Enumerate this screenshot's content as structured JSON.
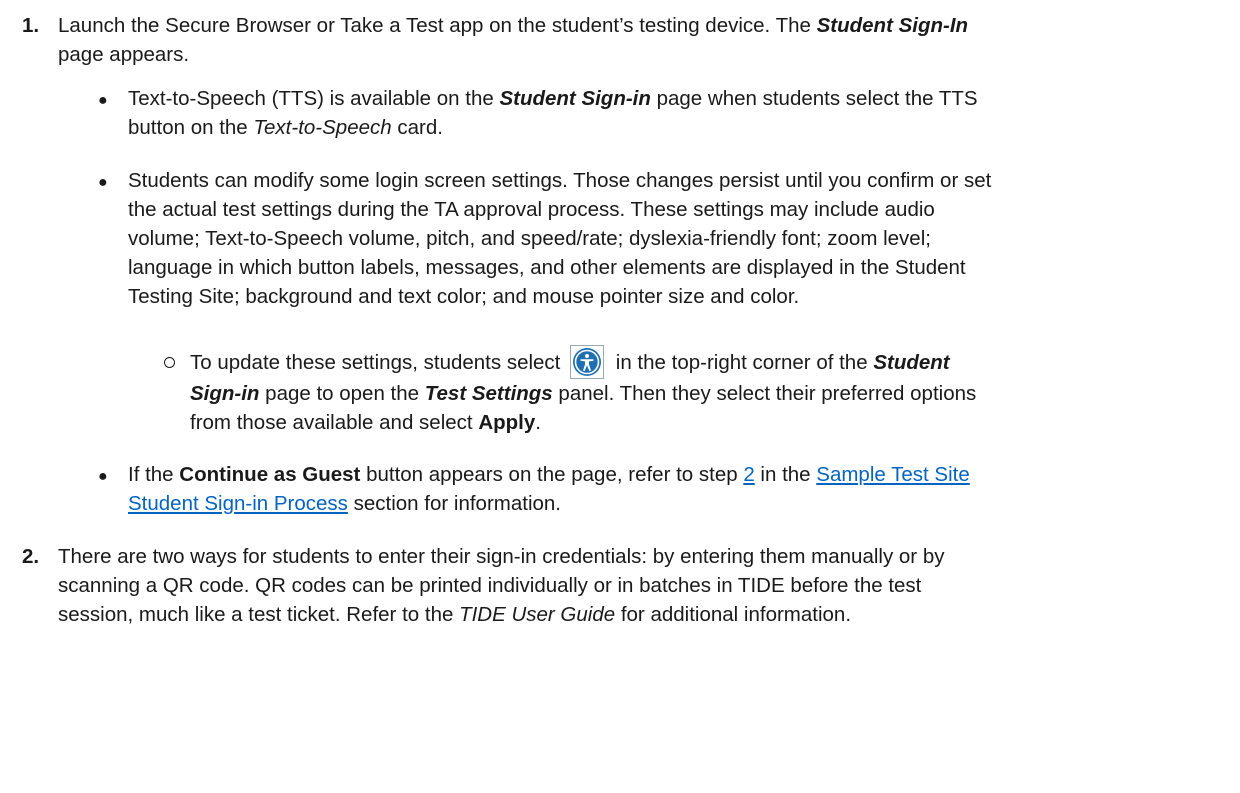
{
  "step1": {
    "number": "1.",
    "p1": "Launch the Secure Browser or Take a Test app on the student’s testing device. The ",
    "p2": "Student Sign-In",
    "p3": "page appears."
  },
  "b1": {
    "t1": "Text-to-Speech (TTS) is available on the ",
    "t2": "Student Sign-in",
    "t3": " page when students select the TTS",
    "t4": "button on the ",
    "t5": "Text-to-Speech",
    "t6": " card."
  },
  "b2": {
    "l1": "Students can modify some login screen settings. Those changes persist until you confirm or set",
    "l2": "the actual test settings during the TA approval process. These settings may include audio",
    "l3": "volume; Text-to-Speech volume, pitch, and speed/rate; dyslexia-friendly font; zoom level;",
    "l4": "language in which button labels, messages, and other elements are displayed in the Student",
    "l5": "Testing Site; background and text color; and mouse pointer size and color."
  },
  "sub": {
    "t1": "To update these settings, students select",
    "t2": " in the top-right corner of the ",
    "t3": "Student",
    "t4": "Sign-in",
    "t5": " page to open the ",
    "t6": "Test Settings",
    "t7": " panel. Then they select their preferred options",
    "t8": "from those available and select ",
    "t9": "Apply",
    "t10": "."
  },
  "b3": {
    "t1": "If the ",
    "t2": "Continue as Guest",
    "t3": " button appears on the page, refer to step ",
    "link_step": "2",
    "t4": " in the ",
    "link_a": "Sample Test Site",
    "link_b": "Student Sign-in Process",
    "t5": " section for information."
  },
  "step2": {
    "number": "2.",
    "l1": "There are two ways for students to enter their sign-in credentials: by entering them manually or by",
    "l2": "scanning a QR code. QR codes can be printed individually or in batches in TIDE before the test",
    "l3a": "session, much like a test ticket. Refer to the ",
    "l3b": "TIDE User Guide",
    "l3c": " for additional information."
  },
  "icons": {
    "accessibility": "accessibility-icon",
    "accent": "#1f6fb2"
  }
}
